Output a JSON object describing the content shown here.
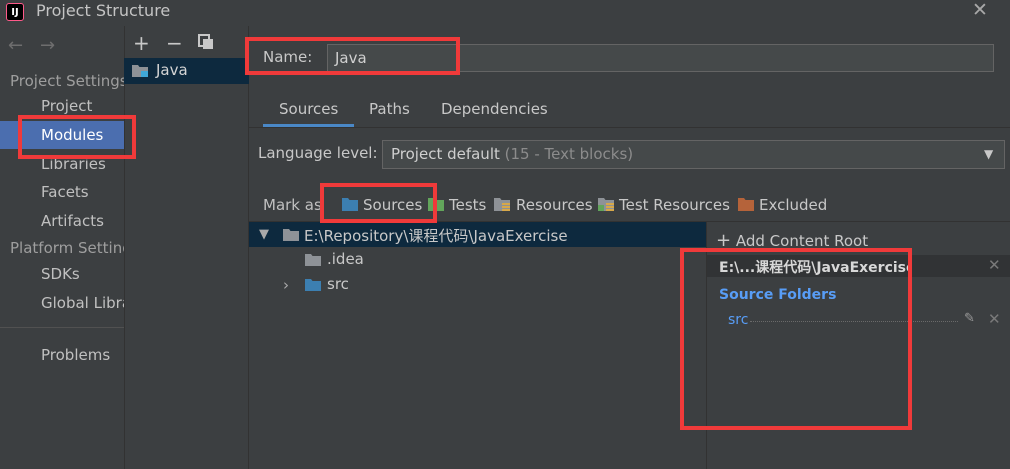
{
  "window": {
    "title": "Project Structure",
    "app_icon_text": "IJ",
    "close_glyph": "✕"
  },
  "nav": {
    "back_icon": "back-arrow-icon",
    "forward_icon": "forward-arrow-icon",
    "project_settings_header": "Project Settings",
    "project_settings_items": [
      "Project",
      "Modules",
      "Libraries",
      "Facets",
      "Artifacts"
    ],
    "platform_settings_header": "Platform Settings",
    "platform_settings_items": [
      "SDKs",
      "Global Libraries"
    ],
    "problems": "Problems",
    "selected": "Modules"
  },
  "module_list": {
    "toolbar": [
      "add-icon",
      "remove-icon",
      "copy-icon"
    ],
    "modules": [
      "Java"
    ]
  },
  "module": {
    "name_label": "Name:",
    "name_value": "Java",
    "tabs": [
      "Sources",
      "Paths",
      "Dependencies"
    ],
    "active_tab": "Sources",
    "language_level_label": "Language level:",
    "language_level_value": "Project default",
    "language_level_hint": "(15 - Text blocks)",
    "mark_as_label": "Mark as",
    "mark_as_options": [
      "Sources",
      "Tests",
      "Resources",
      "Test Resources",
      "Excluded"
    ]
  },
  "tree": {
    "root": "E:\\Repository\\课程代码\\JavaExercise",
    "children": [
      ".idea",
      "src"
    ]
  },
  "content_roots": {
    "add_label": "Add Content Root",
    "root_title": "E:\\...课程代码\\JavaExercise",
    "source_folders_title": "Source Folders",
    "source_folders": [
      "src"
    ]
  },
  "colors": {
    "background": "#3c3f41",
    "selection": "#4b6eaf",
    "tree_selection": "#0d293e",
    "link_blue": "#589df6",
    "highlight_red": "#f03a3a",
    "sources_folder": "#3c7fb1",
    "tests_folder": "#62a55b",
    "excluded_folder": "#b5633a"
  }
}
